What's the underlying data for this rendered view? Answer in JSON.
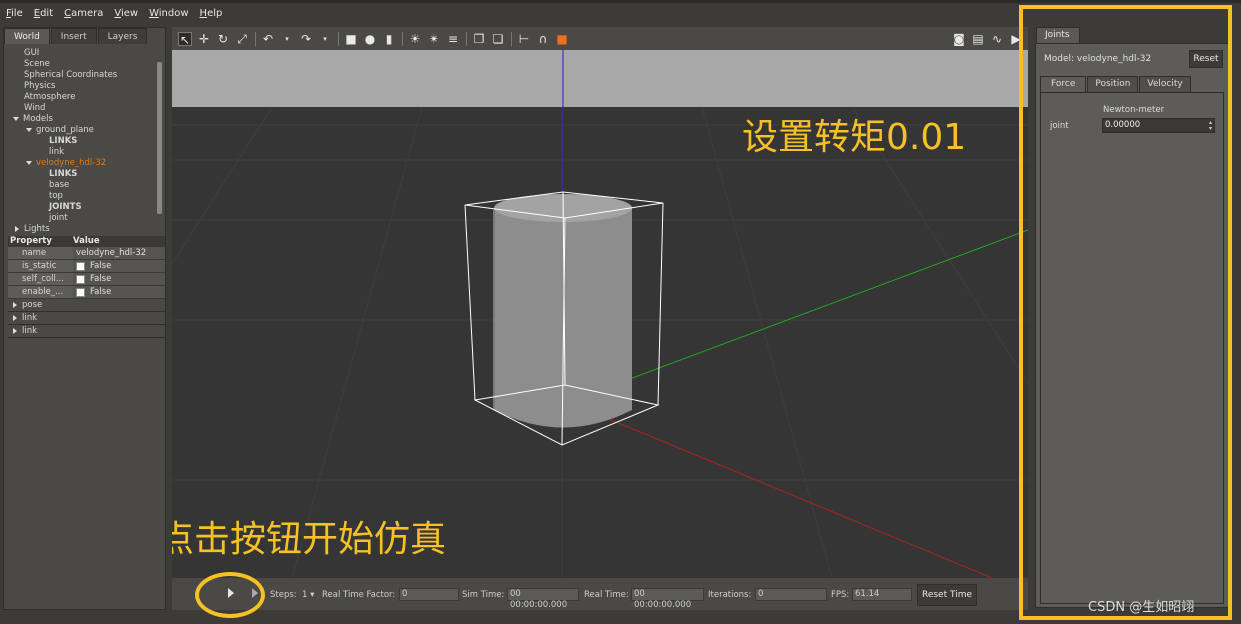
{
  "menubar": {
    "items": [
      {
        "first": "F",
        "rest": "ile"
      },
      {
        "first": "E",
        "rest": "dit"
      },
      {
        "first": "C",
        "rest": "amera"
      },
      {
        "first": "V",
        "rest": "iew"
      },
      {
        "first": "W",
        "rest": "indow"
      },
      {
        "first": "H",
        "rest": "elp"
      }
    ]
  },
  "left": {
    "tabs": [
      "World",
      "Insert",
      "Layers"
    ],
    "tree": {
      "gui": "GUI",
      "scene": "Scene",
      "spherical": "Spherical Coordinates",
      "physics": "Physics",
      "atmosphere": "Atmosphere",
      "wind": "Wind",
      "models": "Models",
      "ground_plane": "ground_plane",
      "links_1": "LINKS",
      "link": "link",
      "velodyne": "velodyne_hdl-32",
      "links_2": "LINKS",
      "base": "base",
      "top": "top",
      "joints": "JOINTS",
      "joint": "joint",
      "lights": "Lights"
    },
    "props": {
      "header_property": "Property",
      "header_value": "Value",
      "rows": [
        {
          "name": "name",
          "value": "velodyne_hdl-32"
        },
        {
          "name": "is_static",
          "value": "False"
        },
        {
          "name": "self_coll...",
          "value": "False"
        },
        {
          "name": "enable_...",
          "value": "False"
        }
      ],
      "folds": [
        "pose",
        "link",
        "link"
      ]
    }
  },
  "bottom": {
    "steps_label": "Steps:",
    "steps_value": "1",
    "rtf_label": "Real Time Factor:",
    "rtf_value": "0",
    "sim_time_label": "Sim Time:",
    "sim_time_value": "00 00:00:00.000",
    "real_time_label": "Real Time:",
    "real_time_value": "00 00:00:00.000",
    "iterations_label": "Iterations:",
    "iterations_value": "0",
    "fps_label": "FPS:",
    "fps_value": "61.14",
    "reset_time": "Reset Time"
  },
  "right": {
    "tab": "Joints",
    "model_label": "Model: velodyne_hdl-32",
    "reset": "Reset",
    "sub_tabs": [
      "Force",
      "Position",
      "Velocity"
    ],
    "unit": "Newton-meter",
    "joint_label": "joint",
    "joint_value": "0.00000"
  },
  "annotations": {
    "set_torque": "设置转矩0.01",
    "click_start": "点击按钮开始仿真"
  },
  "watermark": "CSDN @生如昭翊",
  "colors": {
    "highlight": "#f5c125",
    "selected_model": "#e07a10",
    "z_axis": "#2222cc",
    "y_axis": "#22aa22",
    "x_axis": "#aa2222"
  }
}
